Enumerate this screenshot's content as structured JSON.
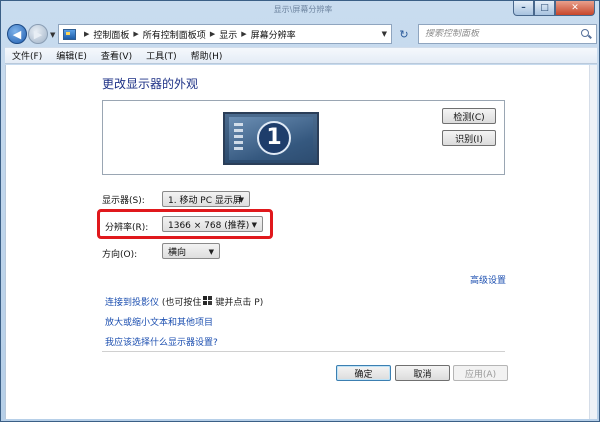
{
  "window": {
    "title": "显示\\屏幕分辨率"
  },
  "nav": {
    "back_symbol": "◀",
    "fwd_symbol": "▶",
    "dropdown_symbol": "▼",
    "refresh_symbol": "↻",
    "breadcrumbs": [
      "控制面板",
      "所有控制面板项",
      "显示",
      "屏幕分辨率"
    ],
    "search_placeholder": "搜索控制面板"
  },
  "menu": {
    "items": [
      "文件(F)",
      "编辑(E)",
      "查看(V)",
      "工具(T)",
      "帮助(H)"
    ]
  },
  "main": {
    "title": "更改显示器的外观",
    "monitor_number": "1",
    "detect_button": "检测(C)",
    "identify_button": "识别(I)",
    "display_label": "显示器(S):",
    "display_value": "1. 移动 PC 显示屏",
    "resolution_label": "分辨率(R):",
    "resolution_value": "1366 × 768 (推荐)",
    "orientation_label": "方向(O):",
    "orientation_value": "横向",
    "advanced_link": "高级设置",
    "projector_link": "连接到投影仪",
    "projector_hint_prefix": "(也可按住",
    "projector_hint_suffix": "键并点击 P)",
    "text_size_link": "放大或缩小文本和其他项目",
    "help_link": "我应该选择什么显示器设置?",
    "ok_button": "确定",
    "cancel_button": "取消",
    "apply_button": "应用(A)"
  },
  "colors": {
    "highlight": "#e0181c",
    "link": "#1c4fb0",
    "title": "#1e3287"
  }
}
